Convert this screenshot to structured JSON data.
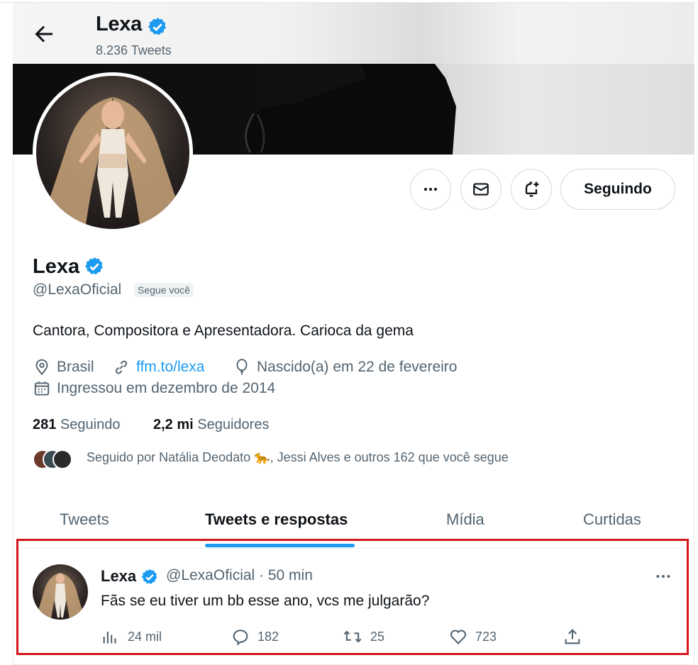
{
  "header": {
    "name": "Lexa",
    "tweet_count": "8.236 Tweets"
  },
  "actions": {
    "follow_label": "Seguindo"
  },
  "profile": {
    "name": "Lexa",
    "handle": "@LexaOficial",
    "follows_you": "Segue você",
    "bio": "Cantora, Compositora e Apresentadora. Carioca da gema",
    "location": "Brasil",
    "website": "ffm.to/lexa",
    "birthday": "Nascido(a) em 22 de fevereiro",
    "joined": "Ingressou em dezembro de 2014",
    "following_count": "281",
    "following_label": "Seguindo",
    "followers_count": "2,2 mi",
    "followers_label": "Seguidores",
    "followed_by": "Seguido por Natália Deodato 🐆, Jessi Alves e outros 162 que você segue"
  },
  "tabs": [
    {
      "label": "Tweets"
    },
    {
      "label": "Tweets e respostas"
    },
    {
      "label": "Mídia"
    },
    {
      "label": "Curtidas"
    }
  ],
  "tweet": {
    "name": "Lexa",
    "handle_time": "@LexaOficial · 50 min",
    "text": "Fãs se eu tiver um bb esse ano, vcs me julgarão?",
    "views": "24 mil",
    "replies": "182",
    "retweets": "25",
    "likes": "723"
  },
  "colors": {
    "accent": "#1d9bf0",
    "highlight_border": "#d4161a",
    "muted": "#536471"
  }
}
